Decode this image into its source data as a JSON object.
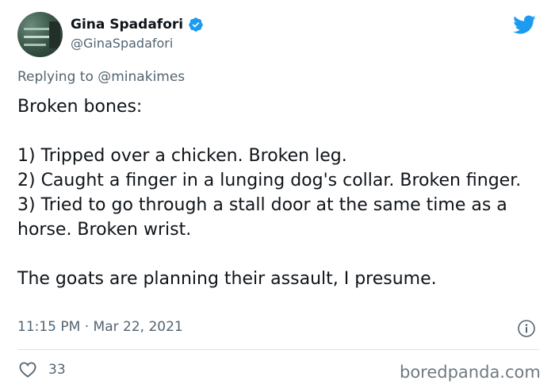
{
  "author": {
    "display_name": "Gina Spadafori",
    "handle": "@GinaSpadafori",
    "verified": true
  },
  "reply": {
    "prefix": "Replying to ",
    "mention": "@minakimes"
  },
  "tweet": {
    "lines": [
      "Broken bones:",
      "",
      "1) Tripped over a chicken. Broken leg.",
      "2) Caught a finger in a lunging dog's collar. Broken finger.",
      "3) Tried to go through a stall door at the same time as a horse. Broken wrist.",
      "",
      "The goats are planning their assault, I presume."
    ]
  },
  "meta": {
    "timestamp": "11:15 PM · Mar 22, 2021"
  },
  "actions": {
    "like_count": "33"
  },
  "icons": {
    "brand": "twitter-bird-icon",
    "verified": "verified-badge-icon",
    "info": "info-icon",
    "like": "heart-icon"
  },
  "colors": {
    "twitter_blue": "#1d9bf0",
    "secondary_text": "#536471",
    "primary_text": "#0f1419"
  },
  "watermark": "boredpanda.com"
}
